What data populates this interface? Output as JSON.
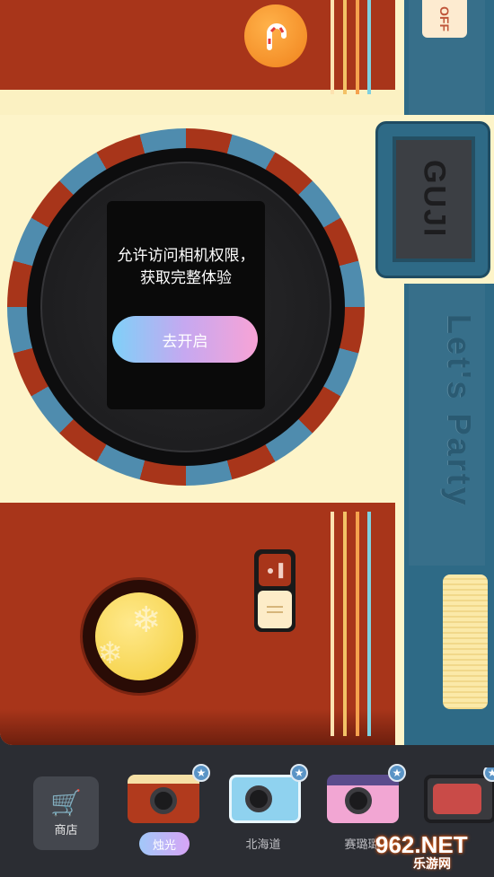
{
  "camera": {
    "off_label": "OFF",
    "brand": "GUJI",
    "strap_text": "Let's Party"
  },
  "permission_dialog": {
    "message_line1": "允许访问相机权限，",
    "message_line2": "获取完整体验",
    "button_label": "去开启"
  },
  "toolbar": {
    "shop_label": "商店",
    "cameras": [
      {
        "label": "烛光",
        "selected": true
      },
      {
        "label": "北海道",
        "selected": false
      },
      {
        "label": "赛璐璐",
        "selected": false
      },
      {
        "label": "",
        "selected": false
      }
    ]
  },
  "watermark": {
    "main": "962.NET",
    "sub": "乐游网"
  },
  "colors": {
    "body_red": "#a8351a",
    "cream": "#fdf4c9",
    "strap_blue": "#2e6a86",
    "toolbar_bg": "#2b2d33"
  }
}
